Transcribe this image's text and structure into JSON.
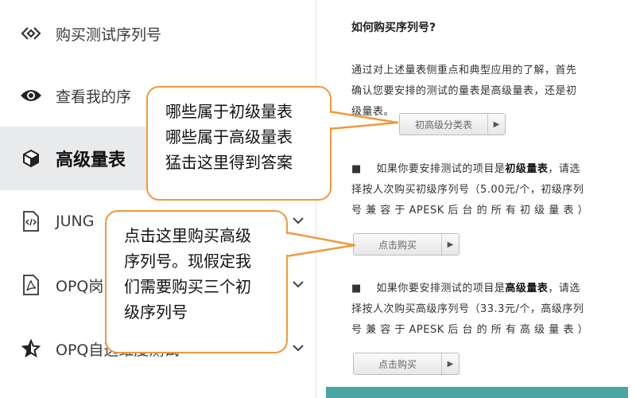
{
  "sidebar": {
    "items": [
      {
        "label": "购买测试序列号",
        "icon": "diamond-link-icon"
      },
      {
        "label": "查看我的序",
        "icon": "eye-icon"
      },
      {
        "label": "高级量表",
        "icon": "cube-icon",
        "active": true
      },
      {
        "label": "JUNG",
        "icon": "code-file-icon",
        "chevron": "v"
      },
      {
        "label": "OPQ岗",
        "icon": "pdf-file-icon",
        "chevron": "v"
      },
      {
        "label": "OPQ自选维度测试",
        "icon": "star-icon",
        "chevron": "v"
      }
    ]
  },
  "panel": {
    "title": "如何购买序列号?",
    "intro_line1": "通过对上述量表侧重点和典型应用的了解，首先",
    "intro_line2": "确认您要安排的测试的量表是高级量表，还是初",
    "intro_line3": "级量表。",
    "category_button": "初高级分类表",
    "basic": {
      "bullet": "■",
      "pre": "如果你要安排测试的项目是",
      "bold": "初级量表",
      "post": "，请选",
      "line2": "择按人次购买初级序列号（5.00元/个，初级序列",
      "line3": "号 兼 容 于 APESK 后 台 的 所 有 初 级 量 表 ）",
      "button": "点击购买"
    },
    "advanced": {
      "bullet": "■",
      "pre": "如果你要安排测试的项目是",
      "bold": "高级量表",
      "post": "，请选",
      "line2": "择按人次购买高级序列号（33.3元/个，高级序列",
      "line3": "号 兼 容 于 APESK 后 台 的 所 有 高 级 量 表 ）",
      "button": "点击购买"
    }
  },
  "callouts": {
    "top": [
      "哪些属于初级量表",
      "哪些属于高级量表",
      "猛击这里得到答案"
    ],
    "bottom": [
      "点击这里购买高级",
      "序列号。现假定我",
      "们需要购买三个初",
      "级序列号"
    ]
  },
  "colors": {
    "callout_border": "#ef9a3d",
    "active_bg": "#e9eaec",
    "teal": "#4aa6a3"
  }
}
